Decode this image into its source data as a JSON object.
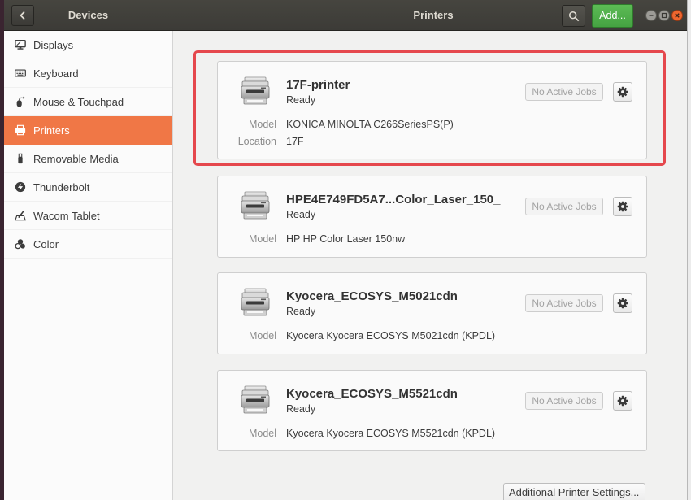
{
  "header": {
    "sidebar_title": "Devices",
    "page_title": "Printers",
    "add_label": "Add...",
    "back_icon": "chevron-left-icon",
    "search_icon": "search-icon",
    "window_controls": [
      "minimize-icon",
      "maximize-icon",
      "close-icon"
    ]
  },
  "sidebar": {
    "items": [
      {
        "label": "Displays",
        "icon": "display-icon"
      },
      {
        "label": "Keyboard",
        "icon": "keyboard-icon"
      },
      {
        "label": "Mouse & Touchpad",
        "icon": "mouse-icon"
      },
      {
        "label": "Printers",
        "icon": "printer-icon",
        "selected": true
      },
      {
        "label": "Removable Media",
        "icon": "usb-drive-icon"
      },
      {
        "label": "Thunderbolt",
        "icon": "thunderbolt-icon"
      },
      {
        "label": "Wacom Tablet",
        "icon": "tablet-icon"
      },
      {
        "label": "Color",
        "icon": "color-icon"
      }
    ]
  },
  "printers": [
    {
      "name": "17F-printer",
      "status": "Ready",
      "model_label": "Model",
      "model": "KONICA MINOLTA C266SeriesPS(P)",
      "location_label": "Location",
      "location": "17F",
      "jobs_label": "No Active Jobs",
      "highlighted": true
    },
    {
      "name": "HPE4E749FD5A7...Color_Laser_150_",
      "status": "Ready",
      "model_label": "Model",
      "model": "HP HP Color Laser 150nw",
      "jobs_label": "No Active Jobs"
    },
    {
      "name": "Kyocera_ECOSYS_M5021cdn",
      "status": "Ready",
      "model_label": "Model",
      "model": "Kyocera Kyocera ECOSYS M5021cdn (KPDL)",
      "jobs_label": "No Active Jobs"
    },
    {
      "name": "Kyocera_ECOSYS_M5521cdn",
      "status": "Ready",
      "model_label": "Model",
      "model": "Kyocera Kyocera ECOSYS M5521cdn (KPDL)",
      "jobs_label": "No Active Jobs"
    }
  ],
  "card_icons": {
    "printer": "printer-icon",
    "settings": "gear-icon"
  },
  "footer": {
    "additional_settings_label": "Additional Printer Settings..."
  },
  "colors": {
    "header_bg": "#3c3b37",
    "selected_row": "#f07746",
    "add_button": "#45a342",
    "close_button": "#f0662e",
    "highlight_border": "#e5484d"
  }
}
